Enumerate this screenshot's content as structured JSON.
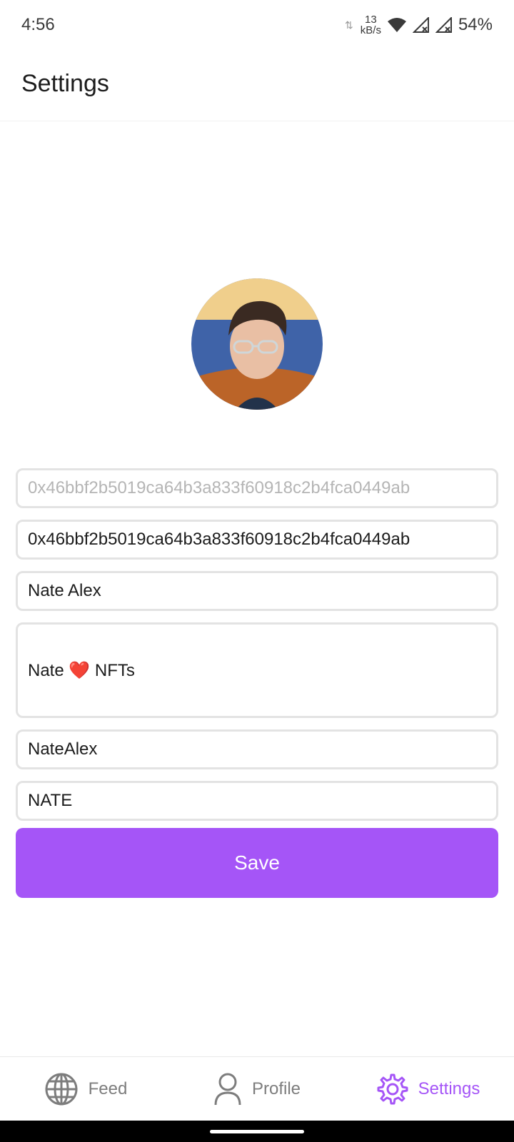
{
  "status": {
    "time": "4:56",
    "net_speed_value": "13",
    "net_speed_unit": "kB/s",
    "battery": "54%"
  },
  "header": {
    "title": "Settings"
  },
  "form": {
    "address_placeholder": "0x46bbf2b5019ca64b3a833f60918c2b4fca0449ab",
    "address_value": "0x46bbf2b5019ca64b3a833f60918c2b4fca0449ab",
    "display_name": "Nate Alex",
    "bio": "Nate ❤️ NFTs",
    "username": "NateAlex",
    "ticker": "NATE",
    "save_label": "Save"
  },
  "nav": {
    "items": [
      {
        "label": "Feed",
        "icon": "globe-icon"
      },
      {
        "label": "Profile",
        "icon": "user-icon"
      },
      {
        "label": "Settings",
        "icon": "gear-icon"
      }
    ],
    "active": "Settings",
    "active_color": "#a555f7",
    "inactive_color": "#7d7d7d"
  }
}
